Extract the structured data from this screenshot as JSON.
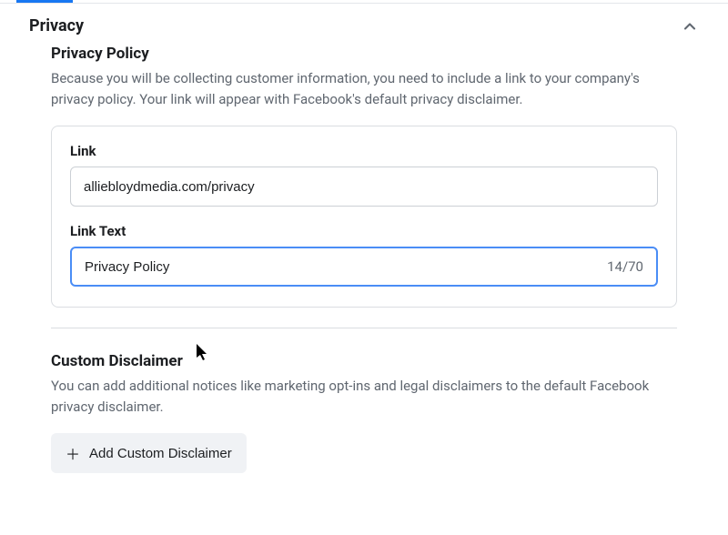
{
  "section": {
    "title": "Privacy"
  },
  "privacy_policy": {
    "heading": "Privacy Policy",
    "description": "Because you will be collecting customer information, you need to include a link to your company's privacy policy. Your link will appear with Facebook's default privacy disclaimer.",
    "link_label": "Link",
    "link_value": "alliebloydmedia.com/privacy",
    "link_text_label": "Link Text",
    "link_text_value": "Privacy Policy",
    "char_count": "14/70"
  },
  "custom_disclaimer": {
    "heading": "Custom Disclaimer",
    "description": "You can add additional notices like marketing opt-ins and legal disclaimers to the default Facebook privacy disclaimer.",
    "button_label": "Add Custom Disclaimer"
  }
}
